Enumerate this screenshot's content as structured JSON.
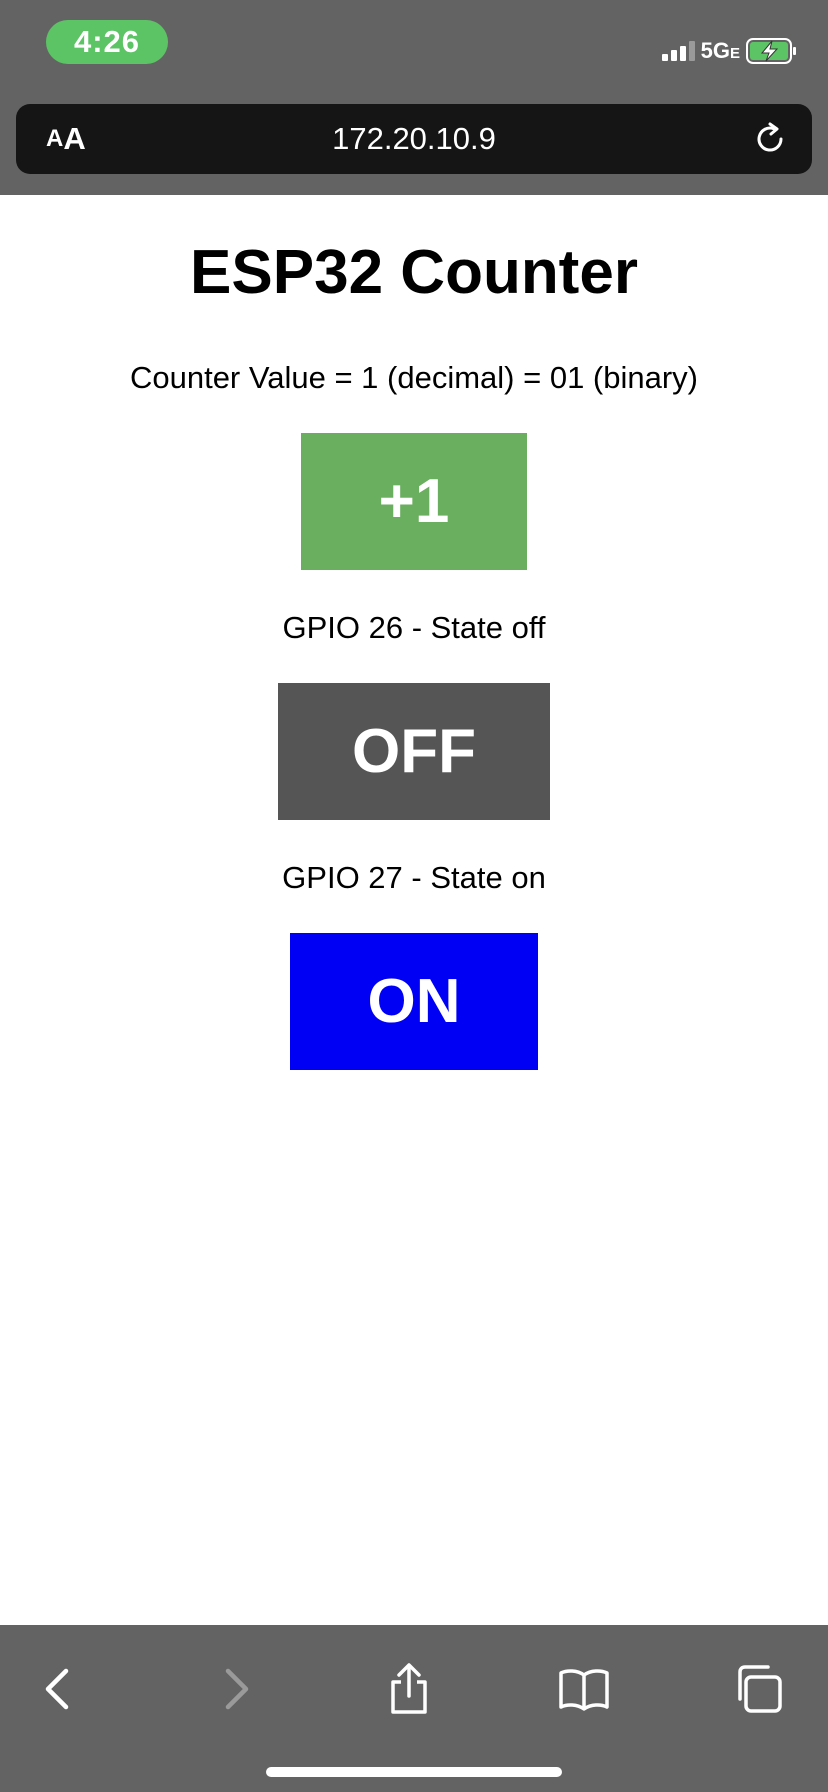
{
  "status_bar": {
    "time": "4:26",
    "network": "5G",
    "network_suffix": "E"
  },
  "browser": {
    "text_size_small": "A",
    "text_size_large": "A",
    "url": "172.20.10.9"
  },
  "page": {
    "title": "ESP32 Counter",
    "counter_text": "Counter Value = 1 (decimal) = 01 (binary)",
    "increment_label": "+1",
    "gpio26_text": "GPIO 26 - State off",
    "gpio26_button_label": "OFF",
    "gpio27_text": "GPIO 27 - State on",
    "gpio27_button_label": "ON"
  },
  "colors": {
    "increment": "#6aae5f",
    "off": "#555555",
    "on": "#0000f5",
    "chrome": "#636363",
    "time_pill": "#5dc466"
  },
  "toolbar": {
    "icons": [
      "back-icon",
      "forward-icon",
      "share-icon",
      "bookmarks-icon",
      "tabs-icon"
    ]
  }
}
